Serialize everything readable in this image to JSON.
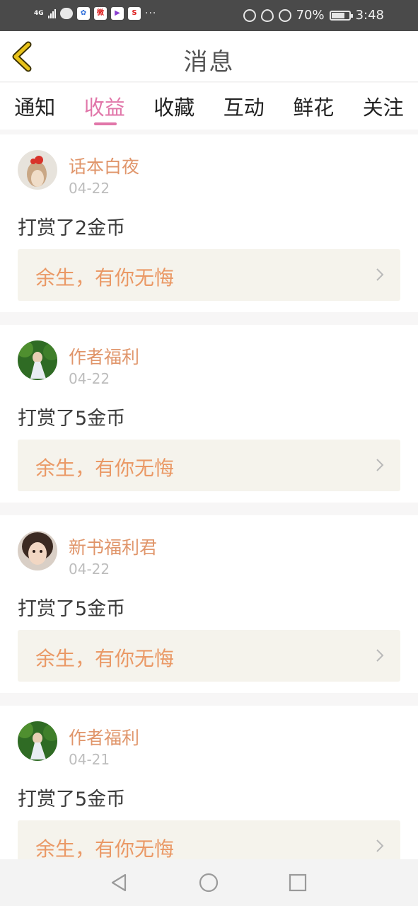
{
  "status_bar": {
    "network": "4G",
    "battery": "70%",
    "time": "3:48",
    "overflow": "···",
    "app_badges": [
      "微",
      "S"
    ]
  },
  "header": {
    "title": "消息"
  },
  "tabs": [
    {
      "label": "通知",
      "active": false
    },
    {
      "label": "收益",
      "active": true
    },
    {
      "label": "收藏",
      "active": false
    },
    {
      "label": "互动",
      "active": false
    },
    {
      "label": "鲜花",
      "active": false
    },
    {
      "label": "关注",
      "active": false
    }
  ],
  "feed": [
    {
      "user": "话本白夜",
      "date": "04-22",
      "message": "打赏了2金币",
      "book": "余生，有你无悔",
      "avatar_icon": "avatar-red-bow-icon"
    },
    {
      "user": "作者福利",
      "date": "04-22",
      "message": "打赏了5金币",
      "book": "余生，有你无悔",
      "avatar_icon": "avatar-forest-girl-icon"
    },
    {
      "user": "新书福利君",
      "date": "04-22",
      "message": "打赏了5金币",
      "book": "余生，有你无悔",
      "avatar_icon": "avatar-girl-face-icon"
    },
    {
      "user": "作者福利",
      "date": "04-21",
      "message": "打赏了5金币",
      "book": "余生，有你无悔",
      "avatar_icon": "avatar-forest-girl-icon"
    }
  ],
  "colors": {
    "accent": "#e176a9",
    "username": "#e0956a",
    "book_title": "#ea9966",
    "book_bg": "#f5f3ec",
    "status_bar": "#4a4a4a",
    "back_arrow": "#e8c21a"
  },
  "nav_bar": {
    "buttons": [
      "back-triangle-icon",
      "home-circle-icon",
      "recents-square-icon"
    ]
  }
}
